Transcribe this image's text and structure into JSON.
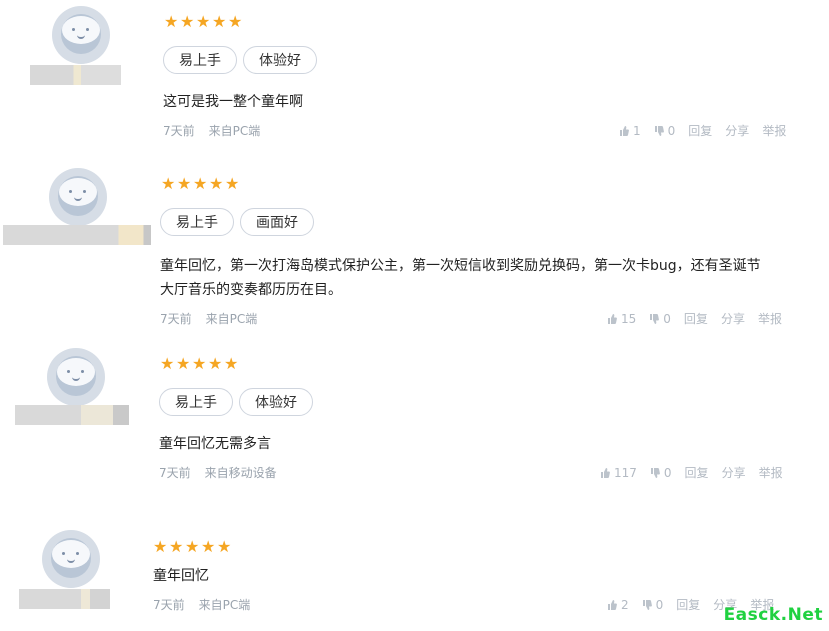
{
  "reviews": [
    {
      "tags": [
        "易上手",
        "体验好"
      ],
      "content": "这可是我一整个童年啊",
      "time": "7天前",
      "source": "来自PC端",
      "likes": "1",
      "dislikes": "0",
      "reply": "回复",
      "share": "分享",
      "report": "举报"
    },
    {
      "tags": [
        "易上手",
        "画面好"
      ],
      "content": "童年回忆，第一次打海岛模式保护公主，第一次短信收到奖励兑换码，第一次卡bug，还有圣诞节\n大厅音乐的变奏都历历在目。",
      "time": "7天前",
      "source": "来自PC端",
      "likes": "15",
      "dislikes": "0",
      "reply": "回复",
      "share": "分享",
      "report": "举报"
    },
    {
      "tags": [
        "易上手",
        "体验好"
      ],
      "content": "童年回忆无需多言",
      "time": "7天前",
      "source": "来自移动设备",
      "likes": "117",
      "dislikes": "0",
      "reply": "回复",
      "share": "分享",
      "report": "举报"
    },
    {
      "tags": [],
      "content": "童年回忆",
      "time": "7天前",
      "source": "来自PC端",
      "likes": "2",
      "dislikes": "0",
      "reply": "回复",
      "share": "分享",
      "report": "举报"
    }
  ],
  "watermark": "Easck.Net",
  "colors": {
    "star": "#f5a623",
    "watermark": "#20d140"
  }
}
